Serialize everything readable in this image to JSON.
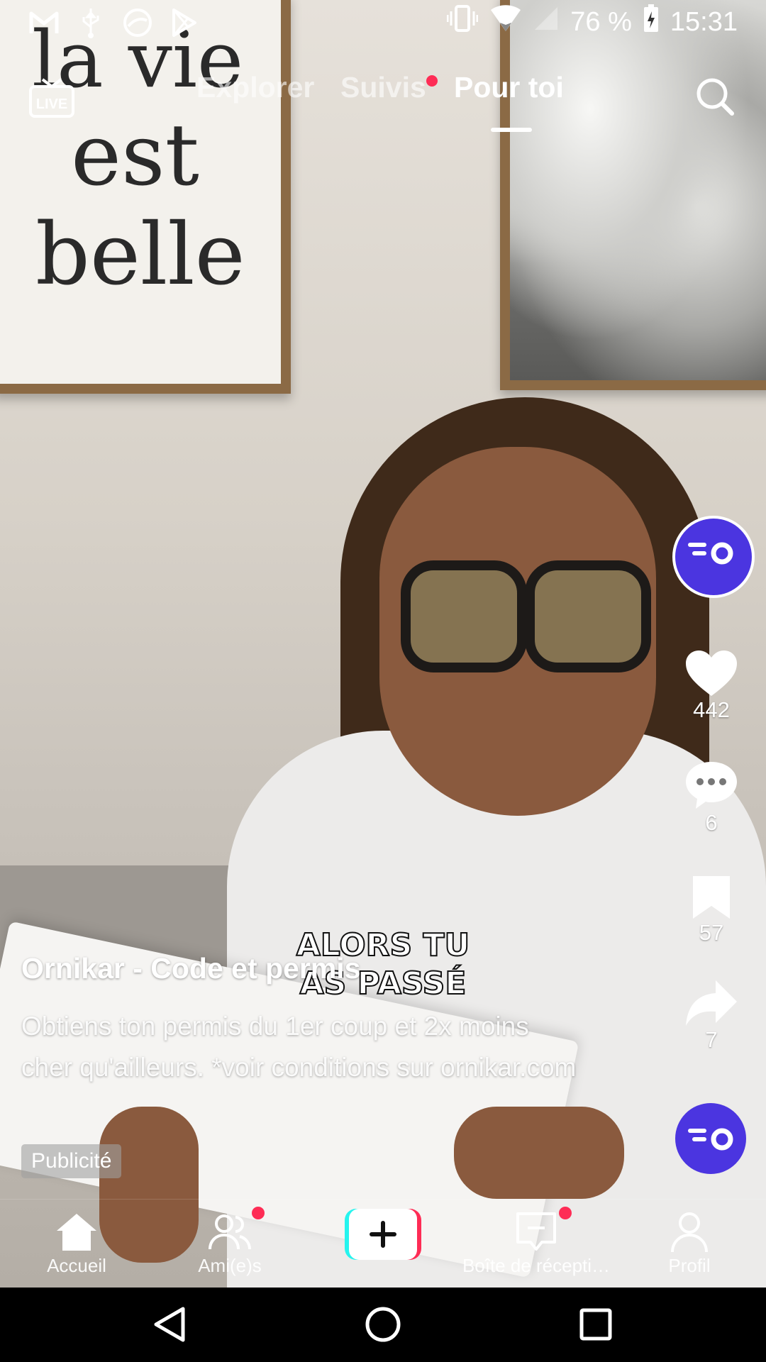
{
  "status_bar": {
    "battery": "76 %",
    "time": "15:31",
    "icons": [
      "gmail-icon",
      "usb-icon",
      "vpn-icon",
      "play-store-icon",
      "vibrate-icon",
      "wifi-icon",
      "signal-icon",
      "battery-charging-icon"
    ]
  },
  "top_nav": {
    "live_label": "LIVE",
    "tabs": [
      {
        "label": "Explorer",
        "active": false
      },
      {
        "label": "Suivis",
        "active": false,
        "has_dot": true
      },
      {
        "label": "Pour toi",
        "active": true
      }
    ]
  },
  "video": {
    "poster_text": [
      "la vie",
      "est",
      "belle"
    ],
    "subtitle": "ALORS TU AS PASSÉ",
    "author": "Ornikar - Code et permis",
    "description": "Obtiens ton permis du 1er coup et 2x moins cher qu'ailleurs. *voir conditions sur ornikar.com",
    "ad_label": "Publicité"
  },
  "actions": {
    "likes": "442",
    "comments": "6",
    "bookmarks": "57",
    "shares": "7"
  },
  "bottom_nav": {
    "items": [
      {
        "label": "Accueil",
        "icon": "home-icon"
      },
      {
        "label": "Ami(e)s",
        "icon": "friends-icon",
        "has_dot": true
      },
      {
        "label": "",
        "icon": "create-icon"
      },
      {
        "label": "Boîte de récepti…",
        "icon": "inbox-icon",
        "has_dot": true
      },
      {
        "label": "Profil",
        "icon": "profile-icon"
      }
    ]
  },
  "colors": {
    "accent_red": "#fe2c55",
    "accent_cyan": "#25f4ee",
    "brand_purple": "#4b35e0"
  }
}
